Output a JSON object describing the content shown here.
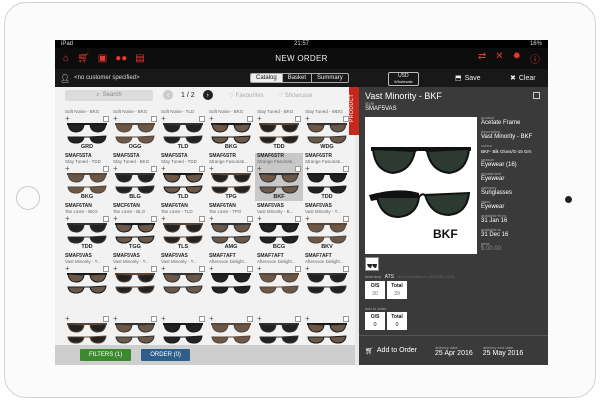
{
  "status": {
    "carrier": "iPad",
    "time": "21:57",
    "battery": "16%"
  },
  "nav": {
    "title": "NEW ORDER",
    "left_icons": [
      "home-icon",
      "cart-icon",
      "customer-icon",
      "users-icon",
      "chart-icon"
    ],
    "right_icons": [
      "transfer-icon",
      "tools-icon",
      "gear-icon",
      "info-icon"
    ]
  },
  "subbar": {
    "customer": "<no customer specified>",
    "tabs": [
      "Catalog",
      "Basket",
      "Summary"
    ],
    "active_tab": "Catalog",
    "currency": "USD",
    "price_type": "Wholesale",
    "save": "Save",
    "clear": "Clear"
  },
  "grid": {
    "search_placeholder": "Search",
    "page": "1 / 2",
    "favourites": "Favourites",
    "showcase": "Showcase",
    "filters": "FILTERS (1)",
    "order": "ORDER (0)",
    "rows": [
      {
        "skus": [
          "",
          "",
          "",
          "",
          "",
          ""
        ],
        "names": [
          "Soft Noise - BKG",
          "Soft Noise - BKG",
          "Soft Noise - TLD",
          "Soft Noise - BKG",
          "Stay Tuned - BKG",
          "Stay Tuned - WDG"
        ],
        "codes": [
          "GRD",
          "OGG",
          "TLD",
          "BKG",
          "TDD",
          "WDG"
        ]
      },
      {
        "skus": [
          "SMAF5STA",
          "SMAF5STA",
          "SMAF5STA",
          "SMAF6STR",
          "SMAF6STR",
          "SMAF6STR"
        ],
        "names": [
          "Stay Tuned - TDD",
          "Stay Tuned - BKG",
          "Stay Tuned - TDD",
          "Strange Fascinati...",
          "Strange Fascinati...",
          "Strange Fascinati..."
        ],
        "codes": [
          "BKG",
          "BLG",
          "TLD",
          "TPG",
          "BKF",
          "TDD"
        ]
      },
      {
        "skus": [
          "SMAF6TAN",
          "SMCF6TAN",
          "SMAF6TAN",
          "SMAF6TAN",
          "SMAF5VAS",
          "SMAF5VAS"
        ],
        "names": [
          "Tan Lines - BKG",
          "Tan Lines - BLG",
          "Tan Lines - TLD",
          "Tan Lines - TPG",
          "Vast Minority - B...",
          "Vast Minority - T..."
        ],
        "codes": [
          "TDD",
          "TGG",
          "TLS",
          "AMG",
          "BCG",
          "BKV"
        ]
      },
      {
        "skus": [
          "SMAF5VAS",
          "SMAF5VAS",
          "SMAF5VAS",
          "SMAF7AFT",
          "SMAF7AFT",
          "SMAF7AFT"
        ],
        "names": [
          "Vast Minority - T...",
          "Vast Minority - T...",
          "Vast Minority - T...",
          "Afternoon Delight...",
          "Afternoon Delight...",
          "Afternoon Delight..."
        ],
        "codes": [
          "",
          "",
          "",
          "",
          "",
          ""
        ]
      },
      {
        "skus": [
          "",
          "",
          "",
          "",
          "",
          ""
        ],
        "names": [
          "",
          "",
          "",
          "",
          "",
          ""
        ],
        "codes": [
          "",
          "",
          "",
          "",
          "",
          ""
        ]
      }
    ]
  },
  "product_tab": "PRODUCT",
  "product": {
    "title": "Vast Minority - BKF",
    "style_label": "style",
    "style": "SMAF5VAS",
    "brand_mark": "BKF",
    "attributes": [
      {
        "label": "product",
        "value": "Acetate Frame"
      },
      {
        "label": "description",
        "value": "Vast Minority - BKF"
      },
      {
        "label": "colour",
        "value": "BKF- Blk Gloss/G-15 Grn"
      },
      {
        "label": "season",
        "value": "Eyewear (16)"
      },
      {
        "label": "department",
        "value": "Eyewear"
      },
      {
        "label": "category",
        "value": "Sunglasses"
      },
      {
        "label": "class",
        "value": "Eyewear"
      },
      {
        "label": "available from",
        "value": "31 Jan 16"
      },
      {
        "label": "available to",
        "value": "31 Dec 16"
      },
      {
        "label": "price",
        "value": "$ 00.00"
      }
    ],
    "inventory_label": "inventory",
    "ats_label": "ATS",
    "ats_note": "Next updated on 13/07/16 13:03",
    "inventory": [
      {
        "label": "O/S",
        "value": "30"
      },
      {
        "label": "Total",
        "value": "39"
      }
    ],
    "add_to_order_label": "add to order",
    "order": [
      {
        "label": "O/S",
        "value": "0"
      },
      {
        "label": "Total",
        "value": "0"
      }
    ],
    "add_button": "Add to Order",
    "delivery_label": "delivery date",
    "delivery_date": "25 Apr 2016",
    "delivery_label2": "delivery end date",
    "delivery_date2": "25 May 2016"
  },
  "colors": {
    "accent": "#e43a2e",
    "filters_btn": "#3c8a2e",
    "order_btn": "#2e5f8a"
  }
}
